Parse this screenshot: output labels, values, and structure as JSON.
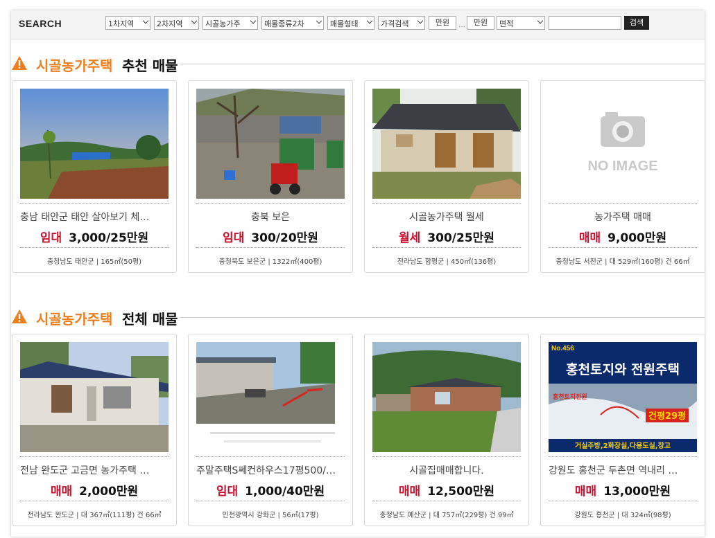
{
  "search": {
    "label": "SEARCH",
    "region1": "1차지역",
    "region2": "2차지역",
    "category": "시골농가주",
    "type2": "매물종류2차",
    "form": "매물형태",
    "price": "가격검색",
    "unit1": "만원",
    "unit2": "만원",
    "area": "면적",
    "keyword": "",
    "button": "검색"
  },
  "sections": [
    {
      "title_orange": "시골농가주택",
      "title_black": "추천 매물",
      "cards": [
        {
          "title": "충남 태안군 태안 살아보기 체…",
          "deal": "임대",
          "price": "3,000/25만원",
          "info": "충청남도 태안군 | 165㎡(50평)",
          "photo_icon": "countryside-field-photo"
        },
        {
          "title": "충북 보은",
          "deal": "임대",
          "price": "300/20만원",
          "info": "충청북도 보은군 | 1322㎡(400평)",
          "photo_icon": "farmhouse-yard-photo"
        },
        {
          "title": "시골농가주택 월세",
          "deal": "월세",
          "price": "300/25만원",
          "info": "전라남도 함평군 | 450㎡(136평)",
          "photo_icon": "hanok-house-photo"
        },
        {
          "title": "농가주택 매매",
          "deal": "매매",
          "price": "9,000만원",
          "info": "충청남도 서천군 | 대 529㎡(160평) 건 66㎡",
          "photo_icon": "no-image-placeholder",
          "no_image_text": "NO IMAGE"
        }
      ]
    },
    {
      "title_orange": "시골농가주택",
      "title_black": "전체 매물",
      "cards": [
        {
          "title": "전남 완도군 고금면 농가주택 …",
          "deal": "매매",
          "price": "2,000만원",
          "info": "전라남도 완도군 | 대 367㎡(111평) 건 66㎡",
          "photo_icon": "white-house-photo"
        },
        {
          "title": "주말주택S쎄컨하우스17평500/…",
          "deal": "임대",
          "price": "1,000/40만원",
          "info": "인천광역시 강화군 | 56㎡(17평)",
          "photo_icon": "house-road-photo"
        },
        {
          "title": "시골집매매합니다.",
          "deal": "매매",
          "price": "12,500만원",
          "info": "충청남도 예산군 | 대 757㎡(229평) 건 99㎡",
          "photo_icon": "brick-house-photo"
        },
        {
          "title": "강원도 홍천군 두촌면 역내리 …",
          "deal": "매매",
          "price": "13,000만원",
          "info": "강원도 홍천군 | 대 324㎡(98평)",
          "photo_icon": "ad-poster-photo",
          "poster": {
            "no": "No.456",
            "headline": "홍천토지와 전원주택",
            "badge": "건평29평",
            "corner": "홍천토지전원",
            "footer": "거실주방,2화장실,다용도실,창고"
          }
        }
      ]
    }
  ]
}
